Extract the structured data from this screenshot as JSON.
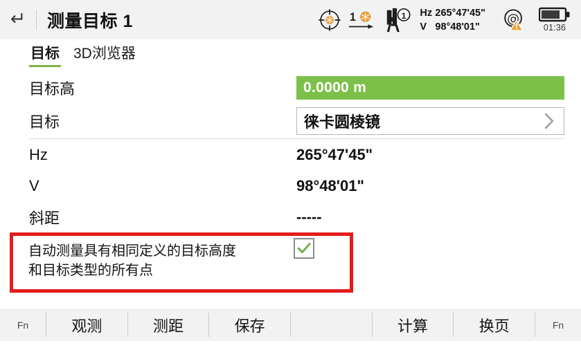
{
  "titlebar": {
    "back_icon": "back-arrow-icon",
    "title": "测量目标 1",
    "status": {
      "crosshair_icon": "crosshair-target-icon",
      "prism_target_icon": "prism-distance-icon",
      "prism_target_number": "1",
      "station_icon": "total-station-icon",
      "station_badge": "1",
      "hz_label": "Hz",
      "hz_value": "265°47'45\"",
      "v_label": "V",
      "v_value": "98°48'01\"",
      "at_icon": "at-sign-warning-icon",
      "battery_icon": "battery-icon",
      "battery_time": "01:36"
    }
  },
  "tabs": [
    {
      "label": "目标",
      "active": true
    },
    {
      "label": "3D浏览器",
      "active": false
    }
  ],
  "rows": [
    {
      "label": "目标高",
      "value": "0.0000 m",
      "type": "green-field"
    },
    {
      "label": "目标",
      "value": "徕卡圆棱镜",
      "type": "select",
      "chevron_icon": "chevron-right-icon"
    },
    {
      "label": "Hz",
      "value": "265°47'45\"",
      "type": "text"
    },
    {
      "label": "V",
      "value": "98°48'01\"",
      "type": "text"
    },
    {
      "label": "斜距",
      "value": "-----",
      "type": "text"
    }
  ],
  "checkbox_row": {
    "text_line1": "自动测量具有相同定义的目标高度",
    "text_line2": "和目标类型的所有点",
    "checked": true,
    "check_icon": "checkmark-icon",
    "highlight_color": "#e51c1c"
  },
  "bottombar": {
    "fn_left": "Fn",
    "buttons": [
      "观测",
      "测距",
      "保存"
    ],
    "buttons_right": [
      "计算",
      "换页"
    ],
    "fn_right": "Fn"
  },
  "colors": {
    "accent_green": "#7cb342",
    "field_green": "#7cc04a",
    "highlight_red": "#e51c1c",
    "bar_gray": "#f2f2f2"
  }
}
